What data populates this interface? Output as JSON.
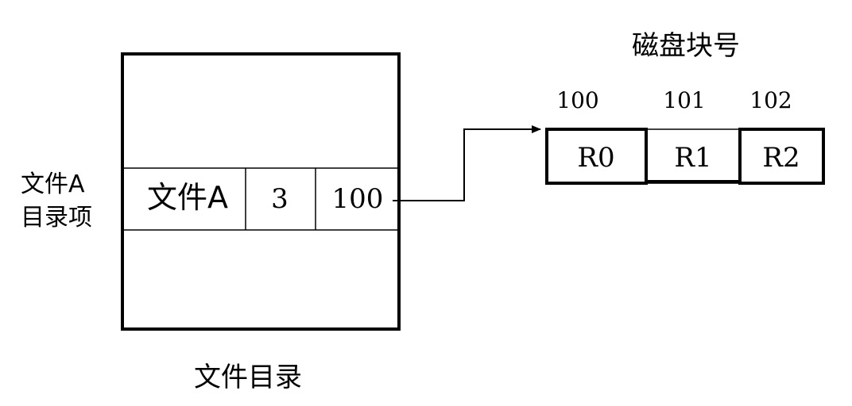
{
  "directory": {
    "title": "文件目录",
    "entry_label_line1": "文件A",
    "entry_label_line2": "目录项",
    "entry": {
      "name": "文件A",
      "length": "3",
      "start_block": "100"
    }
  },
  "disk": {
    "title": "磁盘块号",
    "blocks": [
      {
        "number": "100",
        "content": "R0"
      },
      {
        "number": "101",
        "content": "R1"
      },
      {
        "number": "102",
        "content": "R2"
      }
    ]
  },
  "colors": {
    "stroke": "#000000",
    "background": "#ffffff"
  }
}
